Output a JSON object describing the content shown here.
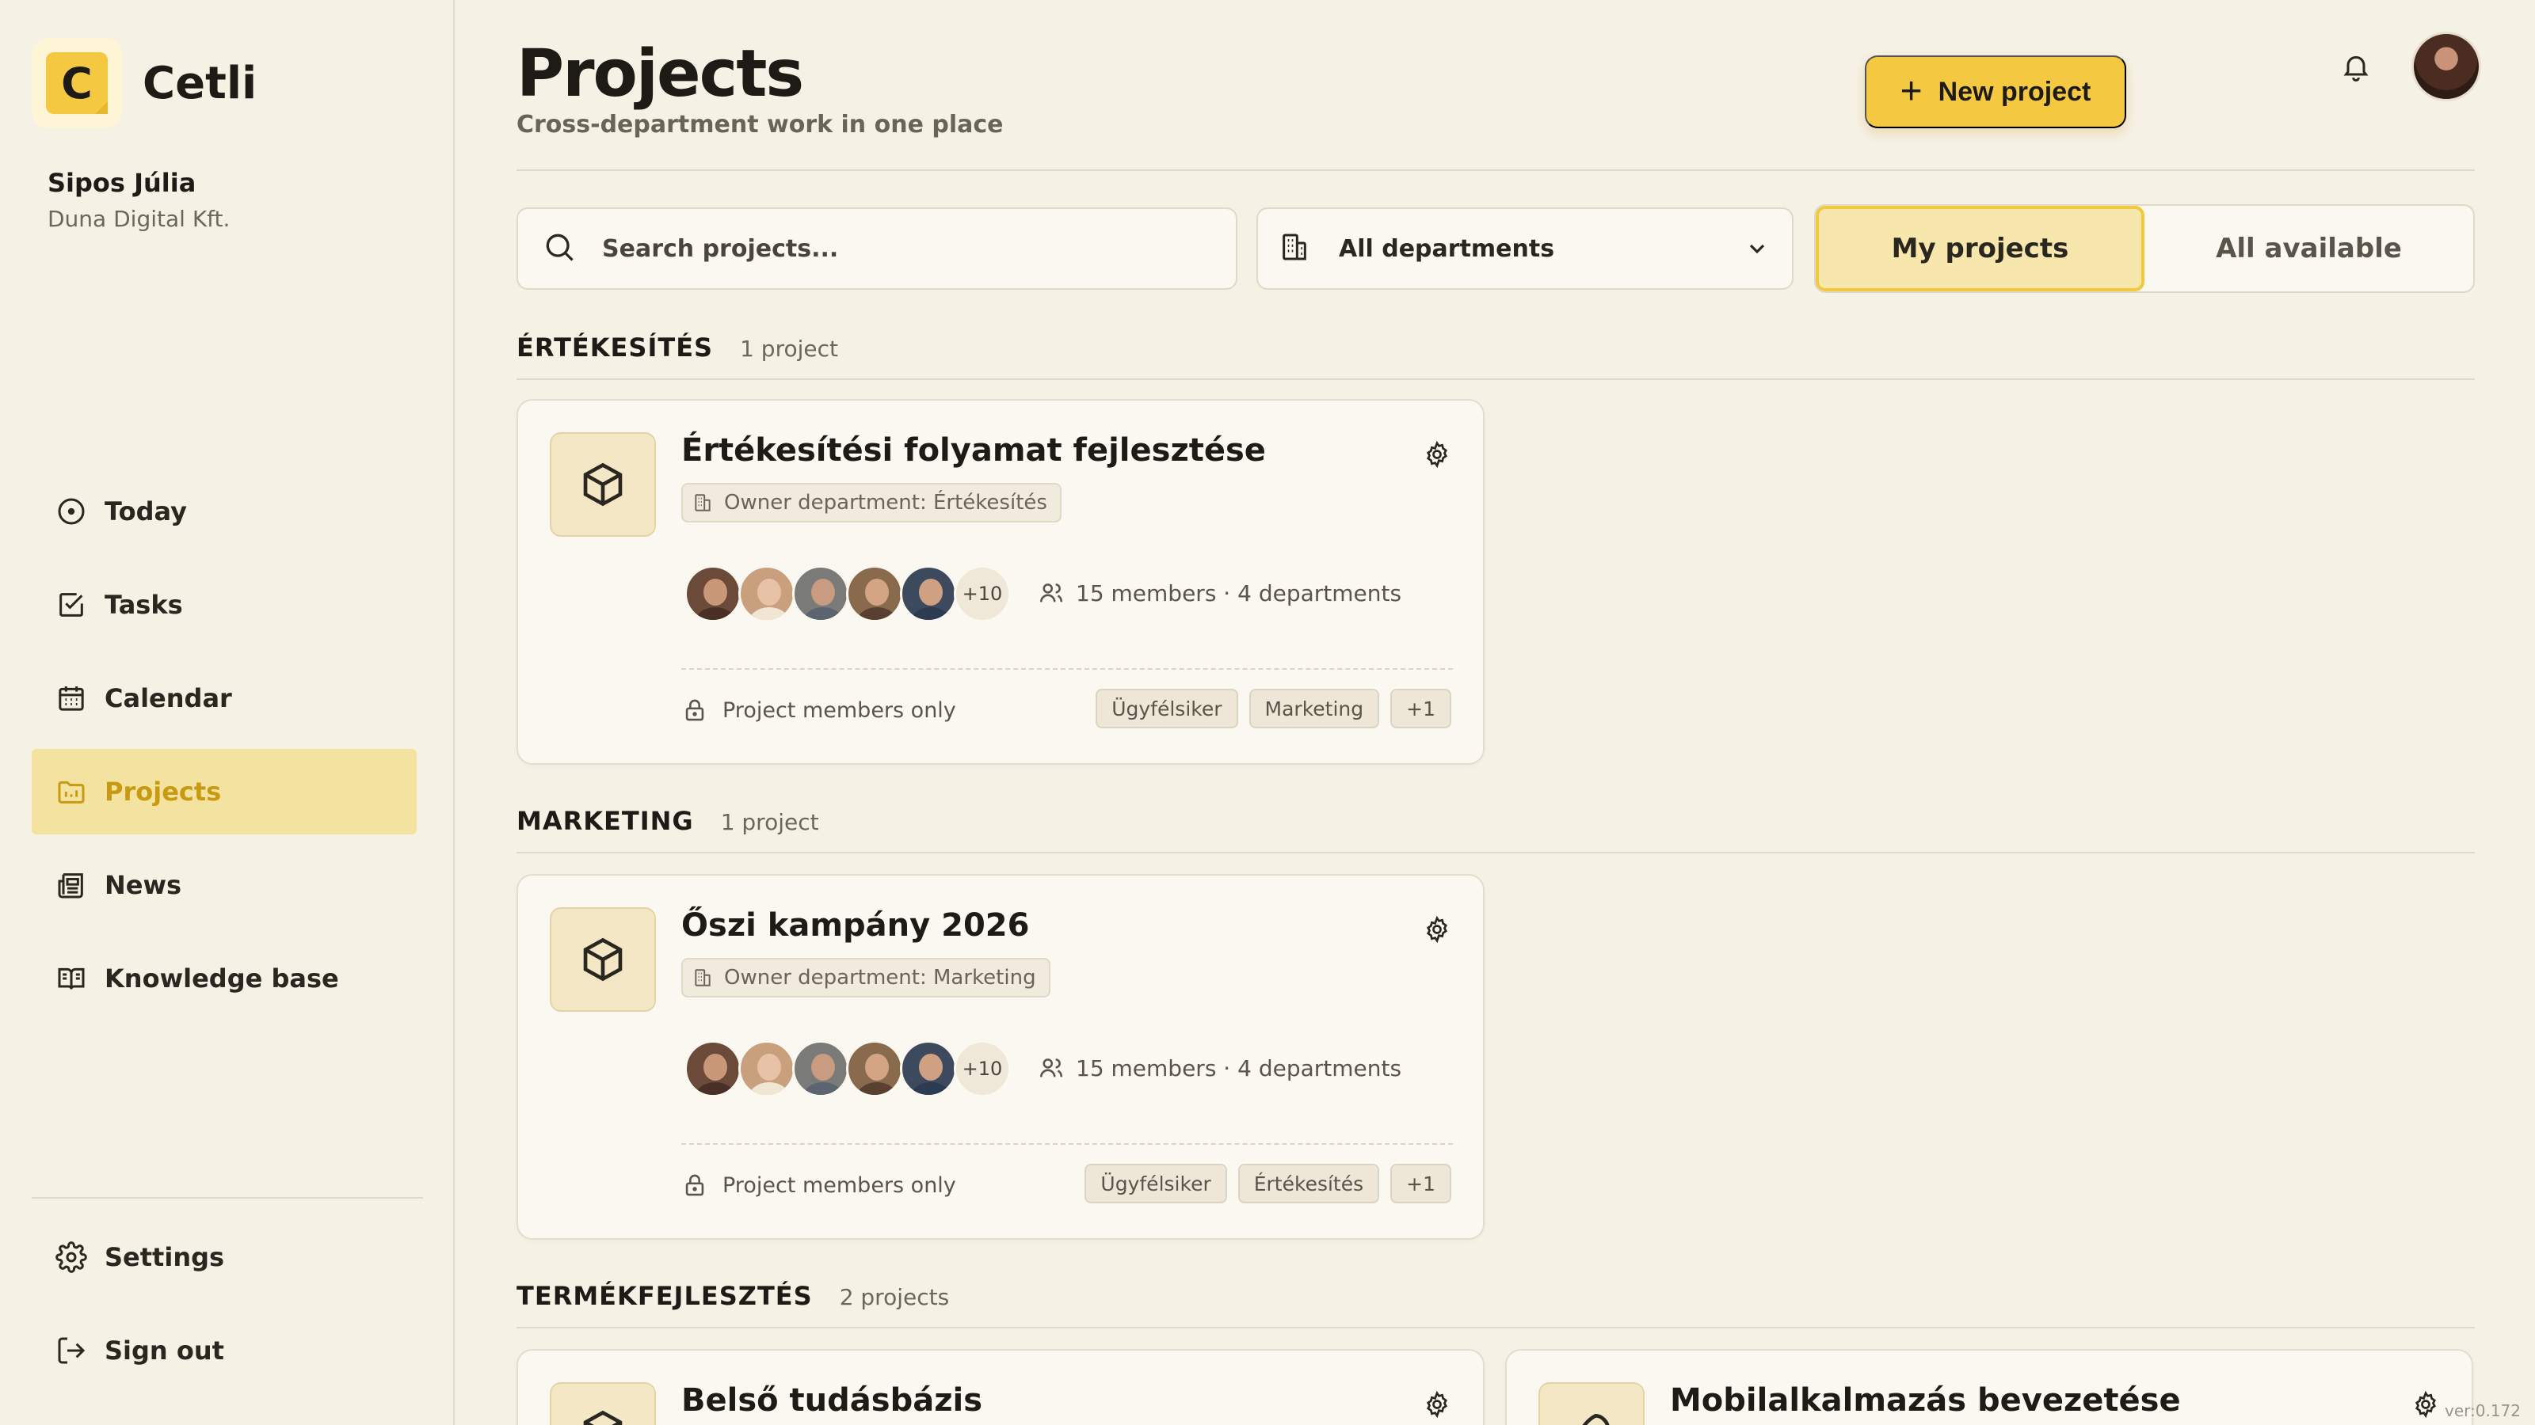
{
  "brand": {
    "logo_letter": "C",
    "name": "Cetli"
  },
  "user": {
    "name": "Sipos Júlia",
    "org": "Duna Digital Kft."
  },
  "nav": {
    "items": [
      {
        "label": "Today",
        "icon": "clock-icon"
      },
      {
        "label": "Tasks",
        "icon": "checkbox-icon"
      },
      {
        "label": "Calendar",
        "icon": "calendar-icon"
      },
      {
        "label": "Projects",
        "icon": "folder-icon",
        "active": true
      },
      {
        "label": "News",
        "icon": "newspaper-icon"
      },
      {
        "label": "Knowledge base",
        "icon": "book-icon"
      }
    ],
    "settings": "Settings",
    "signout": "Sign out"
  },
  "header": {
    "title": "Projects",
    "subtitle": "Cross-department work in one place",
    "new_button": "New project",
    "plus": "+"
  },
  "filters": {
    "search_placeholder": "Search projects...",
    "department": "All departments",
    "toggle": {
      "mine": "My projects",
      "all": "All available",
      "selected": "mine"
    }
  },
  "sections": [
    {
      "name": "ÉRTÉKESÍTÉS",
      "count": "1 project",
      "projects": [
        {
          "title": "Értékesítési folyamat fejlesztése",
          "owner": "Owner department: Értékesítés",
          "more_members": "+10",
          "members": "15 members · 4 departments",
          "access": "Project members only",
          "tags": [
            "Ügyfélsiker",
            "Marketing",
            "+1"
          ]
        }
      ]
    },
    {
      "name": "MARKETING",
      "count": "1 project",
      "projects": [
        {
          "title": "Őszi kampány 2026",
          "owner": "Owner department: Marketing",
          "more_members": "+10",
          "members": "15 members · 4 departments",
          "access": "Project members only",
          "tags": [
            "Ügyfélsiker",
            "Értékesítés",
            "+1"
          ]
        }
      ]
    },
    {
      "name": "TERMÉKFEJLESZTÉS",
      "count": "2 projects",
      "projects": [
        {
          "title": "Belső tudásbázis"
        },
        {
          "title": "Mobilalkalmazás bevezetése"
        }
      ]
    }
  ],
  "version": "ver:0.172",
  "colors": {
    "accent": "#f5c842",
    "active_nav_bg": "#f4e2a1",
    "active_nav_text": "#c79a12",
    "background": "#f6f1e5"
  }
}
